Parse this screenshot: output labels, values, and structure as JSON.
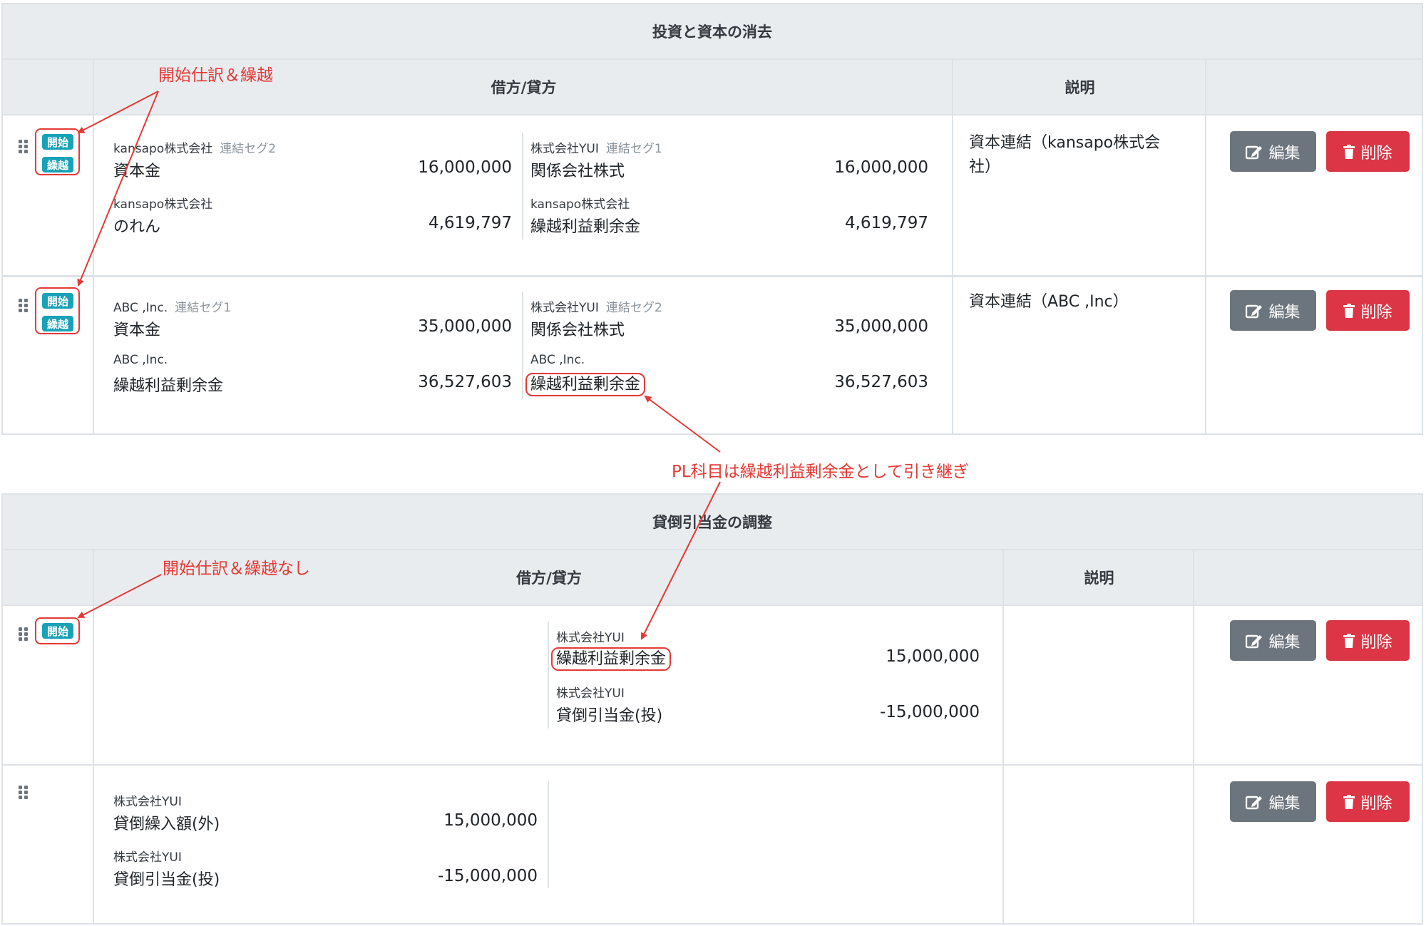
{
  "section1": {
    "title": "投資と資本の消去",
    "col_entries": "借方/貸方",
    "col_description": "説明",
    "rows": [
      {
        "badges": [
          "開始",
          "繰越"
        ],
        "debit": [
          {
            "company": "kansapo株式会社",
            "segment": "連結セグ2",
            "account": "資本金",
            "amount": "16,000,000"
          },
          {
            "company": "kansapo株式会社",
            "segment": "",
            "account": "のれん",
            "amount": "4,619,797"
          }
        ],
        "credit": [
          {
            "company": "株式会社YUI",
            "segment": "連結セグ1",
            "account": "関係会社株式",
            "amount": "16,000,000"
          },
          {
            "company": "kansapo株式会社",
            "segment": "",
            "account": "繰越利益剰余金",
            "amount": "4,619,797"
          }
        ],
        "description": "資本連結（kansapo株式会社）",
        "edit_label": "編集",
        "delete_label": "削除"
      },
      {
        "badges": [
          "開始",
          "繰越"
        ],
        "debit": [
          {
            "company": "ABC ,Inc.",
            "segment": "連結セグ1",
            "account": "資本金",
            "amount": "35,000,000"
          },
          {
            "company": "ABC ,Inc.",
            "segment": "",
            "account": "繰越利益剰余金",
            "amount": "36,527,603"
          }
        ],
        "credit": [
          {
            "company": "株式会社YUI",
            "segment": "連結セグ2",
            "account": "関係会社株式",
            "amount": "35,000,000"
          },
          {
            "company": "ABC ,Inc.",
            "segment": "",
            "account": "繰越利益剰余金",
            "amount": "36,527,603"
          }
        ],
        "description": "資本連結（ABC ,Inc）",
        "edit_label": "編集",
        "delete_label": "削除"
      }
    ]
  },
  "section2": {
    "title": "貸倒引当金の調整",
    "col_entries": "借方/貸方",
    "col_description": "説明",
    "rows": [
      {
        "badges": [
          "開始"
        ],
        "debit": [],
        "credit": [
          {
            "company": "株式会社YUI",
            "segment": "",
            "account": "繰越利益剰余金",
            "amount": "15,000,000"
          },
          {
            "company": "株式会社YUI",
            "segment": "",
            "account": "貸倒引当金(投)",
            "amount": "-15,000,000"
          }
        ],
        "description": "",
        "edit_label": "編集",
        "delete_label": "削除"
      },
      {
        "badges": [],
        "debit": [
          {
            "company": "株式会社YUI",
            "segment": "",
            "account": "貸倒繰入額(外)",
            "amount": "15,000,000"
          },
          {
            "company": "株式会社YUI",
            "segment": "",
            "account": "貸倒引当金(投)",
            "amount": "-15,000,000"
          }
        ],
        "credit": [],
        "description": "",
        "edit_label": "編集",
        "delete_label": "削除"
      }
    ]
  },
  "annotations": {
    "opening_carryover": "開始仕訳＆繰越",
    "pl_carryover": "PL科目は繰越利益剰余金として引き継ぎ",
    "opening_no_carryover": "開始仕訳＆繰越なし"
  },
  "colors": {
    "badge": "#17a2b8",
    "edit_button": "#6c757d",
    "delete_button": "#dc3545",
    "annotation": "#e53935",
    "header_bg": "#e9ecef"
  },
  "icons": {
    "drag": "drag-handle-icon",
    "edit": "edit-icon",
    "delete": "trash-icon"
  }
}
